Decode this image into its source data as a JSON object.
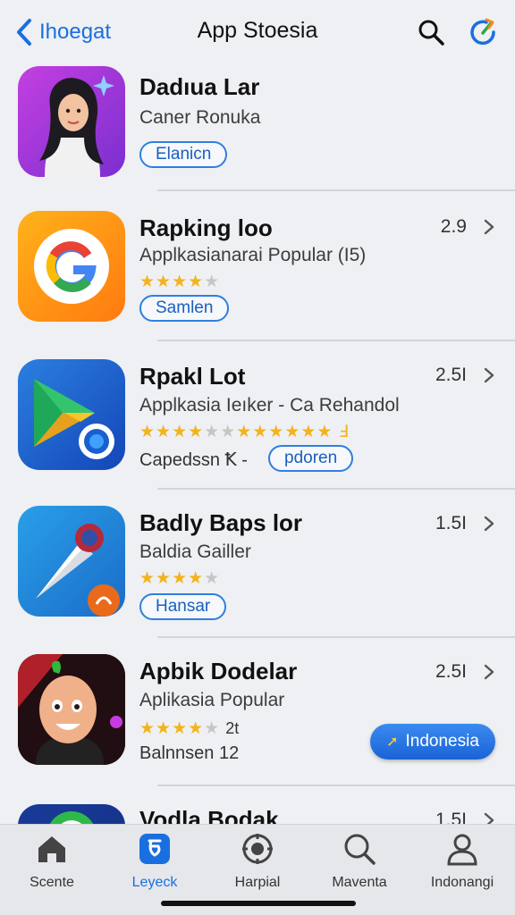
{
  "header": {
    "back_label": "Ihoegat",
    "title": "App Stoesia"
  },
  "apps": [
    {
      "name": "Dadıua Lar",
      "subtitle": "Caner Ronuka",
      "button": "Elanicn",
      "icon": "woman-avatar-icon"
    },
    {
      "name": "Rapking loo",
      "subtitle": "Applkasianarai Popular (I5)",
      "rating": "2.9",
      "stars_filled": 4,
      "stars_total": 5,
      "button": "Samlen",
      "icon": "google-g-icon"
    },
    {
      "name": "Rpakl Lot",
      "subtitle": "Applkasia Ieıker - Ca Rehandol",
      "rating": "2.5I",
      "stars_filled": 4,
      "stars_total": 5,
      "stars_extra": "★★★★★★ Ⅎ",
      "caption": "Capedssn Ꝁ -",
      "button": "pdoren",
      "icon": "play-store-icon"
    },
    {
      "name": "Badly Baps lor",
      "subtitle": "Baldia Gailler",
      "rating": "1.5I",
      "stars_filled": 4,
      "stars_total": 5,
      "button": "Hansar",
      "icon": "pin-tool-icon"
    },
    {
      "name": "Apbik Dodelar",
      "subtitle": "Aplikasia Popular",
      "rating": "2.5I",
      "stars_filled": 4,
      "stars_total": 5,
      "stars_extra": "2t",
      "caption": "Balnnsen 12",
      "cta": "Indonesia",
      "icon": "cartoon-face-icon"
    },
    {
      "name": "Vodla Bodak",
      "rating": "1.5I",
      "icon": "app-icon"
    }
  ],
  "tabs": [
    {
      "label": "Scente",
      "icon": "home-icon",
      "active": false
    },
    {
      "label": "Leyeck",
      "icon": "apps-icon",
      "active": true
    },
    {
      "label": "Harpial",
      "icon": "games-icon",
      "active": false
    },
    {
      "label": "Maventa",
      "icon": "search-icon",
      "active": false
    },
    {
      "label": "Indonangi",
      "icon": "account-icon",
      "active": false
    }
  ],
  "colors": {
    "accent": "#1a6fe0",
    "background": "#eef0f3",
    "star": "#f3b31a"
  }
}
